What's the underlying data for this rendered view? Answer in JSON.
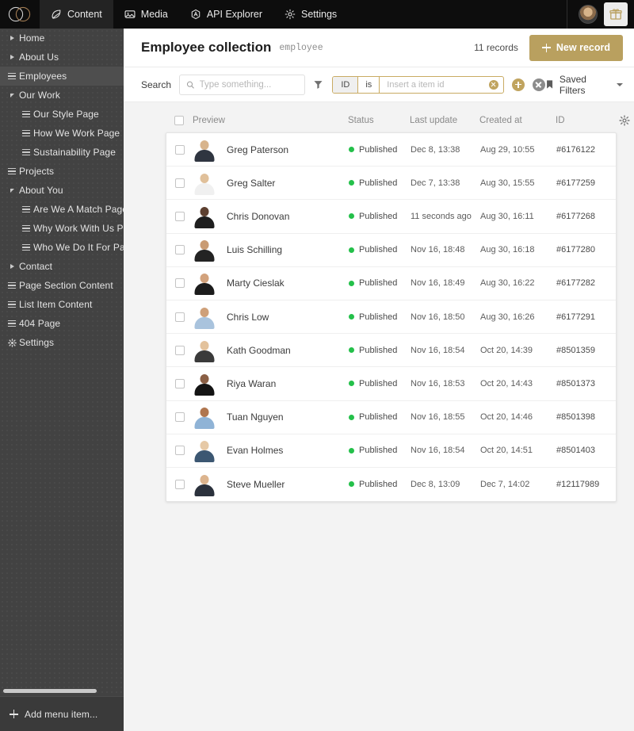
{
  "topnav": {
    "logo_icon": "venn-circles-logo",
    "tabs": [
      {
        "label": "Content",
        "icon": "feather-icon",
        "active": true
      },
      {
        "label": "Media",
        "icon": "image-icon",
        "active": false
      },
      {
        "label": "API Explorer",
        "icon": "api-icon",
        "active": false
      },
      {
        "label": "Settings",
        "icon": "gear-icon",
        "active": false
      }
    ],
    "avatar": "user-avatar",
    "gift_icon": "gift-icon"
  },
  "sidebar": {
    "items": [
      {
        "label": "Home",
        "icon": "triangle-right-icon",
        "level": 1,
        "active": false
      },
      {
        "label": "About Us",
        "icon": "triangle-right-icon",
        "level": 1,
        "active": false
      },
      {
        "label": "Employees",
        "icon": "list-icon",
        "level": 1,
        "active": true
      },
      {
        "label": "Our Work",
        "icon": "triangle-down-icon",
        "level": 1,
        "active": false
      },
      {
        "label": "Our Style Page",
        "icon": "list-icon",
        "level": 2,
        "active": false
      },
      {
        "label": "How We Work Page",
        "icon": "list-icon",
        "level": 2,
        "active": false
      },
      {
        "label": "Sustainability Page",
        "icon": "list-icon",
        "level": 2,
        "active": false
      },
      {
        "label": "Projects",
        "icon": "list-icon",
        "level": 1,
        "active": false
      },
      {
        "label": "About You",
        "icon": "triangle-down-icon",
        "level": 1,
        "active": false
      },
      {
        "label": "Are We A Match Page",
        "icon": "list-icon",
        "level": 2,
        "active": false
      },
      {
        "label": "Why Work With Us Page",
        "icon": "list-icon",
        "level": 2,
        "active": false
      },
      {
        "label": "Who We Do It For Page",
        "icon": "list-icon",
        "level": 2,
        "active": false
      },
      {
        "label": "Contact",
        "icon": "triangle-right-icon",
        "level": 1,
        "active": false
      },
      {
        "label": "Page Section Content",
        "icon": "list-icon",
        "level": 1,
        "active": false
      },
      {
        "label": "List Item Content",
        "icon": "list-icon",
        "level": 1,
        "active": false
      },
      {
        "label": "404 Page",
        "icon": "list-icon",
        "level": 1,
        "active": false
      },
      {
        "label": "Settings",
        "icon": "gear-icon",
        "level": 1,
        "active": false
      }
    ],
    "add_menu_item_label": "Add menu item..."
  },
  "header": {
    "title": "Employee collection",
    "slug": "employee",
    "records_count": "11 records",
    "new_record_label": "New record"
  },
  "filters": {
    "search_label": "Search",
    "search_value": "",
    "search_placeholder": "Type something...",
    "funnel_icon": "filter-funnel-icon",
    "condition_field": "ID",
    "condition_operator": "is",
    "condition_value": "",
    "condition_placeholder": "Insert a item id",
    "add_condition_icon": "plus-circle-icon",
    "clear_condition_icon": "clear-circle-icon",
    "saved_filters_label": "Saved Filters",
    "bookmark_icon": "bookmark-icon",
    "caret_icon": "chevron-down-icon"
  },
  "table": {
    "columns": [
      "Preview",
      "Status",
      "Last update",
      "Created at",
      "ID"
    ],
    "settings_icon": "gear-icon",
    "rows": [
      {
        "name": "Greg Paterson",
        "status": "Published",
        "last_update": "Dec 8, 13:38",
        "created_at": "Aug 29, 10:55",
        "id": "#6176122",
        "skin": "#d8b48c",
        "shirt": "#2f3540"
      },
      {
        "name": "Greg Salter",
        "status": "Published",
        "last_update": "Dec 7, 13:38",
        "created_at": "Aug 30, 15:55",
        "id": "#6177259",
        "skin": "#e0c09a",
        "shirt": "#f0f0f0"
      },
      {
        "name": "Chris Donovan",
        "status": "Published",
        "last_update": "11 seconds ago",
        "created_at": "Aug 30, 16:11",
        "id": "#6177268",
        "skin": "#5d4030",
        "shirt": "#1e1e1e"
      },
      {
        "name": "Luis Schilling",
        "status": "Published",
        "last_update": "Nov 16, 18:48",
        "created_at": "Aug 30, 16:18",
        "id": "#6177280",
        "skin": "#c99b73",
        "shirt": "#232323"
      },
      {
        "name": "Marty Cieslak",
        "status": "Published",
        "last_update": "Nov 16, 18:49",
        "created_at": "Aug 30, 16:22",
        "id": "#6177282",
        "skin": "#d2a27c",
        "shirt": "#1c1c1c"
      },
      {
        "name": "Chris Low",
        "status": "Published",
        "last_update": "Nov 16, 18:50",
        "created_at": "Aug 30, 16:26",
        "id": "#6177291",
        "skin": "#cfa079",
        "shirt": "#a9c3dd"
      },
      {
        "name": "Kath Goodman",
        "status": "Published",
        "last_update": "Nov 16, 18:54",
        "created_at": "Oct 20, 14:39",
        "id": "#8501359",
        "skin": "#e3c29c",
        "shirt": "#3a3a3a"
      },
      {
        "name": "Riya Waran",
        "status": "Published",
        "last_update": "Nov 16, 18:53",
        "created_at": "Oct 20, 14:43",
        "id": "#8501373",
        "skin": "#8a5f45",
        "shirt": "#141414"
      },
      {
        "name": "Tuan Nguyen",
        "status": "Published",
        "last_update": "Nov 16, 18:55",
        "created_at": "Oct 20, 14:46",
        "id": "#8501398",
        "skin": "#b0764f",
        "shirt": "#8fb3d6"
      },
      {
        "name": "Evan Holmes",
        "status": "Published",
        "last_update": "Nov 16, 18:54",
        "created_at": "Oct 20, 14:51",
        "id": "#8501403",
        "skin": "#e6c9a6",
        "shirt": "#3c5772"
      },
      {
        "name": "Steve Mueller",
        "status": "Published",
        "last_update": "Dec 8, 13:09",
        "created_at": "Dec 7, 14:02",
        "id": "#12117989",
        "skin": "#dcb48e",
        "shirt": "#2b313c"
      }
    ]
  },
  "colors": {
    "accent_gold": "#b9a05f",
    "status_green": "#24c04a",
    "sidebar_bg": "#424242",
    "topnav_bg": "#0d0d0d"
  }
}
